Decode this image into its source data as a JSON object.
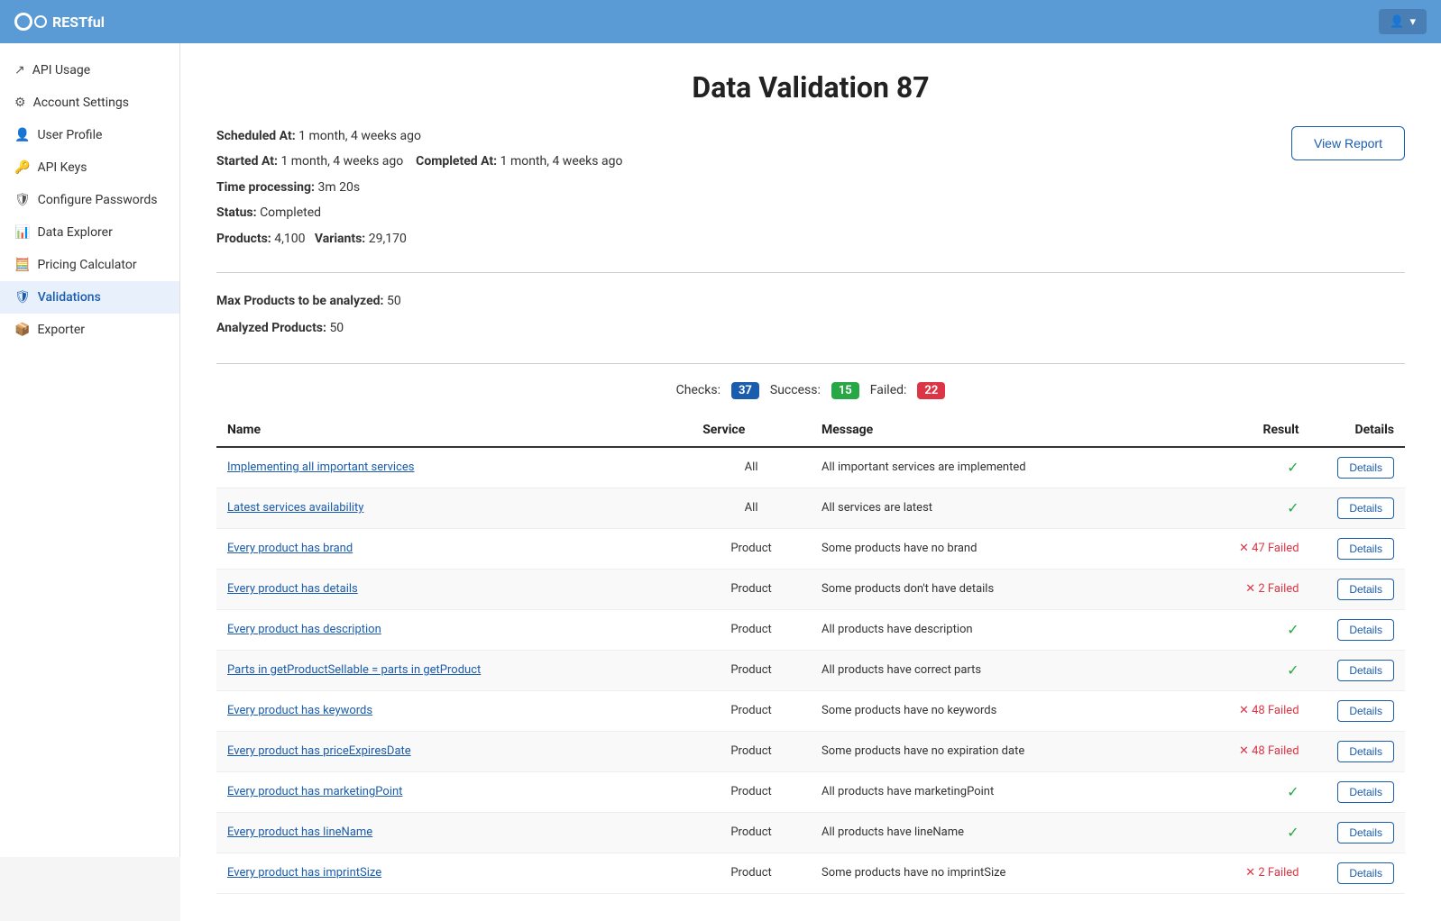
{
  "topbar": {
    "logo_text": "RESTful",
    "user_button_label": "▾"
  },
  "sidebar": {
    "items": [
      {
        "id": "api-usage",
        "label": "API Usage",
        "icon": "↗",
        "active": false
      },
      {
        "id": "account-settings",
        "label": "Account Settings",
        "icon": "⚙",
        "active": false
      },
      {
        "id": "user-profile",
        "label": "User Profile",
        "icon": "👤",
        "active": false
      },
      {
        "id": "api-keys",
        "label": "API Keys",
        "icon": "🔑",
        "active": false
      },
      {
        "id": "configure-passwords",
        "label": "Configure Passwords",
        "icon": "🛡",
        "active": false
      },
      {
        "id": "data-explorer",
        "label": "Data Explorer",
        "icon": "📊",
        "active": false
      },
      {
        "id": "pricing-calculator",
        "label": "Pricing Calculator",
        "icon": "🧮",
        "active": false
      },
      {
        "id": "validations",
        "label": "Validations",
        "icon": "🛡",
        "active": true
      },
      {
        "id": "exporter",
        "label": "Exporter",
        "icon": "📦",
        "active": false
      }
    ]
  },
  "page": {
    "title": "Data Validation 87",
    "scheduled_at_label": "Scheduled At:",
    "scheduled_at_value": "1 month, 4 weeks ago",
    "started_at_label": "Started At:",
    "started_at_value": "1 month, 4 weeks ago",
    "completed_at_label": "Completed At:",
    "completed_at_value": "1 month, 4 weeks ago",
    "time_processing_label": "Time processing:",
    "time_processing_value": "3m 20s",
    "status_label": "Status:",
    "status_value": "Completed",
    "products_label": "Products:",
    "products_value": "4,100",
    "variants_label": "Variants:",
    "variants_value": "29,170",
    "view_report_label": "View Report",
    "max_products_label": "Max Products to be analyzed:",
    "max_products_value": "50",
    "analyzed_products_label": "Analyzed Products:",
    "analyzed_products_value": "50",
    "checks_label": "Checks:",
    "checks_value": "37",
    "success_label": "Success:",
    "success_value": "15",
    "failed_label": "Failed:",
    "failed_value": "22"
  },
  "table": {
    "headers": [
      "Name",
      "Service",
      "Message",
      "Result",
      "Details"
    ],
    "rows": [
      {
        "name": "Implementing all important services",
        "service": "All",
        "message": "All important services are implemented",
        "result_type": "success",
        "result_text": "✓",
        "details_label": "Details"
      },
      {
        "name": "Latest services availability",
        "service": "All",
        "message": "All services are latest",
        "result_type": "success",
        "result_text": "✓",
        "details_label": "Details"
      },
      {
        "name": "Every product has brand",
        "service": "Product",
        "message": "Some products have no brand",
        "result_type": "failed",
        "result_text": "× 47 Failed",
        "details_label": "Details"
      },
      {
        "name": "Every product has details",
        "service": "Product",
        "message": "Some products don't have details",
        "result_type": "failed",
        "result_text": "× 2 Failed",
        "details_label": "Details"
      },
      {
        "name": "Every product has description",
        "service": "Product",
        "message": "All products have description",
        "result_type": "success",
        "result_text": "✓",
        "details_label": "Details"
      },
      {
        "name": "Parts in getProductSellable = parts in getProduct",
        "service": "Product",
        "message": "All products have correct parts",
        "result_type": "success",
        "result_text": "✓",
        "details_label": "Details"
      },
      {
        "name": "Every product has keywords",
        "service": "Product",
        "message": "Some products have no keywords",
        "result_type": "failed",
        "result_text": "× 48 Failed",
        "details_label": "Details"
      },
      {
        "name": "Every product has priceExpiresDate",
        "service": "Product",
        "message": "Some products have no expiration date",
        "result_type": "failed",
        "result_text": "× 48 Failed",
        "details_label": "Details"
      },
      {
        "name": "Every product has marketingPoint",
        "service": "Product",
        "message": "All products have marketingPoint",
        "result_type": "success",
        "result_text": "✓",
        "details_label": "Details"
      },
      {
        "name": "Every product has lineName",
        "service": "Product",
        "message": "All products have lineName",
        "result_type": "success",
        "result_text": "✓",
        "details_label": "Details"
      },
      {
        "name": "Every product has imprintSize",
        "service": "Product",
        "message": "Some products have no imprintSize",
        "result_type": "failed",
        "result_text": "× 2 Failed",
        "details_label": "Details"
      }
    ]
  }
}
